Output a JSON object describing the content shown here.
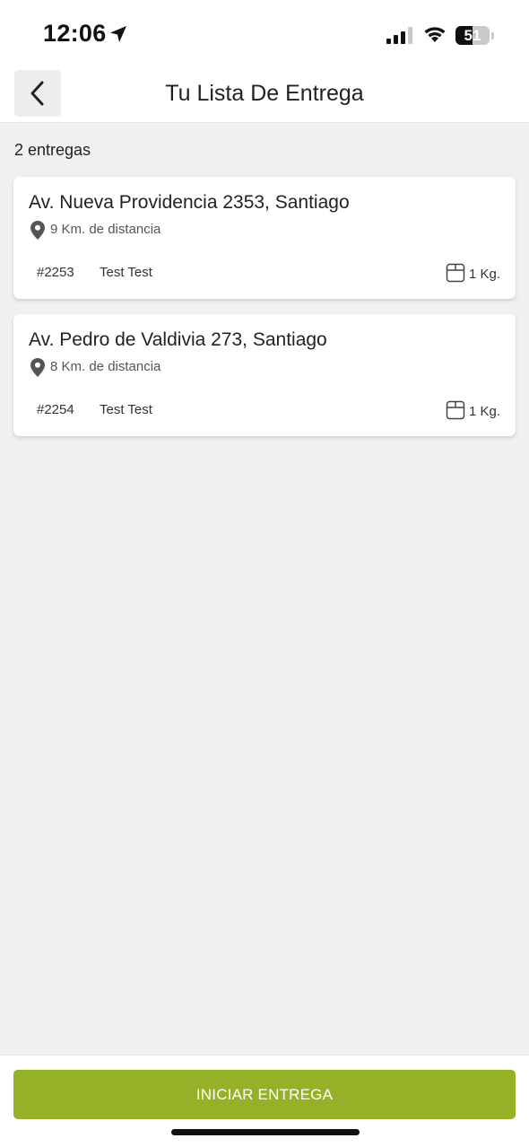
{
  "status_bar": {
    "time": "12:06",
    "battery_percent": "51",
    "battery_level": 0.51
  },
  "header": {
    "title": "Tu Lista De Entrega"
  },
  "deliveries_count": "2 entregas",
  "deliveries": [
    {
      "address": "Av. Nueva Providencia 2353, Santiago",
      "distance": "9 Km. de distancia",
      "order": "#2253",
      "customer": "Test Test",
      "weight": "1 Kg."
    },
    {
      "address": "Av. Pedro de Valdivia 273, Santiago",
      "distance": "8 Km. de distancia",
      "order": "#2254",
      "customer": "Test Test",
      "weight": "1 Kg."
    }
  ],
  "footer": {
    "button_label": "INICIAR ENTREGA"
  },
  "colors": {
    "accent": "#95b128",
    "background": "#f0f0f2"
  },
  "icons": [
    "location-arrow-icon",
    "signal-icon",
    "wifi-icon",
    "battery-icon",
    "chevron-left-icon",
    "map-pin-icon",
    "package-icon"
  ]
}
